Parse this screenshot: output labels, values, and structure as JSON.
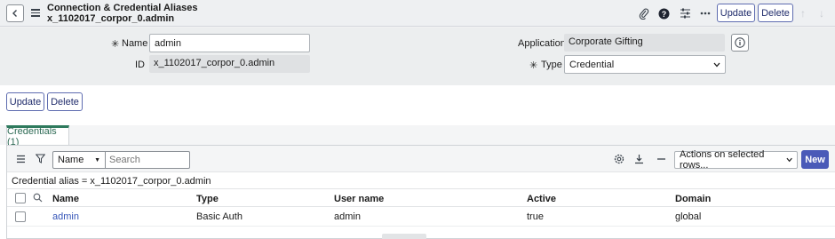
{
  "header": {
    "title_line1": "Connection & Credential Aliases",
    "title_line2": "x_1102017_corpor_0.admin",
    "update_label": "Update",
    "delete_label": "Delete",
    "icons": [
      "back-icon",
      "hamburger-icon",
      "paperclip-icon",
      "help-icon",
      "settings-sliders-icon",
      "more-icon",
      "arrow-up-icon",
      "arrow-down-icon"
    ]
  },
  "form": {
    "name_label": "Name",
    "name_value": "admin",
    "id_label": "ID",
    "id_value": "x_1102017_corpor_0.admin",
    "application_label": "Application",
    "application_value": "Corporate Gifting",
    "type_label": "Type",
    "type_value": "Credential",
    "required_marker": "✳"
  },
  "actions": {
    "update_label": "Update",
    "delete_label": "Delete"
  },
  "tabs": [
    {
      "label": "Credentials (1)"
    }
  ],
  "list": {
    "search_field": "Name",
    "search_placeholder": "Search",
    "actions_select": "Actions on selected rows...",
    "new_label": "New",
    "filter_text": "Credential alias = x_1102017_corpor_0.admin",
    "columns": [
      "Name",
      "Type",
      "User name",
      "Active",
      "Domain"
    ],
    "rows": [
      {
        "name": "admin",
        "type": "Basic Auth",
        "user_name": "admin",
        "active": "true",
        "domain": "global"
      }
    ]
  },
  "colors": {
    "accent_button": "#4a5ab8",
    "tab_accent": "#2e7a5d",
    "link": "#3555b8"
  }
}
